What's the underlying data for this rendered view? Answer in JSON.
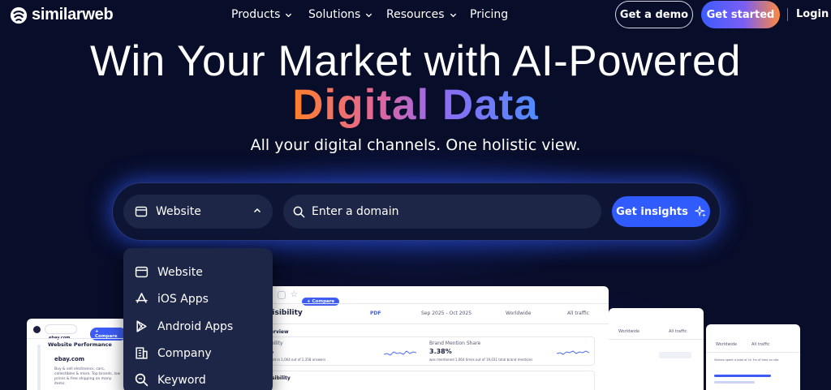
{
  "nav": {
    "logo_text": "similarweb",
    "items": [
      {
        "label": "Products",
        "has_dropdown": true
      },
      {
        "label": "Solutions",
        "has_dropdown": true
      },
      {
        "label": "Resources",
        "has_dropdown": true
      },
      {
        "label": "Pricing",
        "has_dropdown": false
      }
    ],
    "demo_label": "Get a demo",
    "start_label": "Get started",
    "login_label": "Login"
  },
  "hero": {
    "line1": "Win Your Market with AI-Powered",
    "line2": "Digital Data",
    "subtitle": "All your digital channels. One holistic view."
  },
  "search": {
    "type_selected": "Website",
    "placeholder": "Enter a domain",
    "button_label": "Get insights"
  },
  "dropdown": {
    "items": [
      {
        "label": "Website",
        "icon": "browser-window-icon"
      },
      {
        "label": "iOS Apps",
        "icon": "app-store-icon"
      },
      {
        "label": "Android Apps",
        "icon": "google-play-icon"
      },
      {
        "label": "Company",
        "icon": "building-icon"
      },
      {
        "label": "Keyword",
        "icon": "search-icon"
      }
    ]
  },
  "preview": {
    "left_card": {
      "domain_tab": "ebay.com",
      "compare_label": "+ Compare",
      "title": "Website Performance",
      "site": "ebay.com",
      "description": "Buy & sell electronics, cars, collectibles & more. Top brands, low prices & free shipping on many items."
    },
    "main_card": {
      "compare_label": "+ Compare",
      "title": "d Visibility",
      "pdf_label": "PDF",
      "date_range": "Sep 2025 - Oct 2025",
      "region": "Worldwide",
      "traffic": "All traffic",
      "section_overview": "verview",
      "metric1_title": "sibility",
      "metric1_value": "%",
      "metric1_note": "ioned in 1,064 out of 2,358 answers",
      "metric2_title": "Brand Mention Share",
      "metric2_value": "3.38%",
      "metric2_note": "was mentioned 1,064 times out of 19,031 total brand mentions",
      "section_visibility": "visibility"
    },
    "right_card_b": {
      "region": "Worldwide",
      "traffic": "All traffic"
    },
    "right_card_c": {
      "region": "Worldwide",
      "traffic": "All traffic",
      "note": "Visitors spent a total of 1h 3m of time on site"
    }
  },
  "colors": {
    "background": "#080d2a",
    "accent": "#2f5bff",
    "gradient_start": "#ff7f2a",
    "gradient_end": "#4f8bff"
  }
}
